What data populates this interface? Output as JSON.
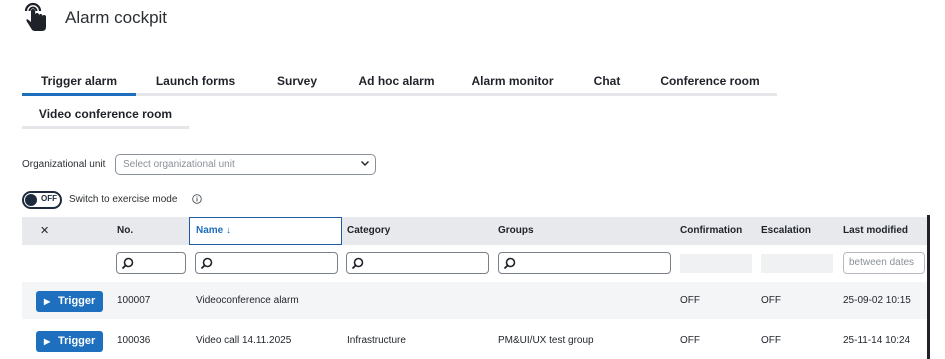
{
  "header": {
    "title": "Alarm cockpit",
    "icon": "touch-hand-icon"
  },
  "tabs": [
    {
      "label": "Trigger alarm",
      "active": true
    },
    {
      "label": "Launch forms"
    },
    {
      "label": "Survey"
    },
    {
      "label": "Ad hoc alarm"
    },
    {
      "label": "Alarm monitor"
    },
    {
      "label": "Chat"
    },
    {
      "label": "Conference room"
    },
    {
      "label": "Video conference room"
    }
  ],
  "filters": {
    "org_label": "Organizational unit",
    "org_placeholder": "Select organizational unit",
    "toggle_state": "OFF",
    "switch_label": "Switch to exercise mode"
  },
  "table": {
    "columns": {
      "clear": "✕",
      "no": "No.",
      "name": "Name",
      "category": "Category",
      "groups": "Groups",
      "confirmation": "Confirmation",
      "escalation": "Escalation",
      "last_modified": "Last modified"
    },
    "date_placeholder": "between dates",
    "trigger_label": "Trigger",
    "rows": [
      {
        "no": "100007",
        "name": "Videoconference alarm",
        "category": "",
        "groups": "",
        "confirmation": "OFF",
        "escalation": "OFF",
        "last_modified": "25-09-02 10:15"
      },
      {
        "no": "100036",
        "name": "Video call 14.11.2025",
        "category": "Infrastructure",
        "groups": "PM&UI/UX test group",
        "confirmation": "OFF",
        "escalation": "OFF",
        "last_modified": "25-11-14 10:24"
      }
    ]
  },
  "colors": {
    "accent": "#1f6fbf",
    "header_bg": "#e7e9ed",
    "row_alt": "#f4f5f7"
  }
}
